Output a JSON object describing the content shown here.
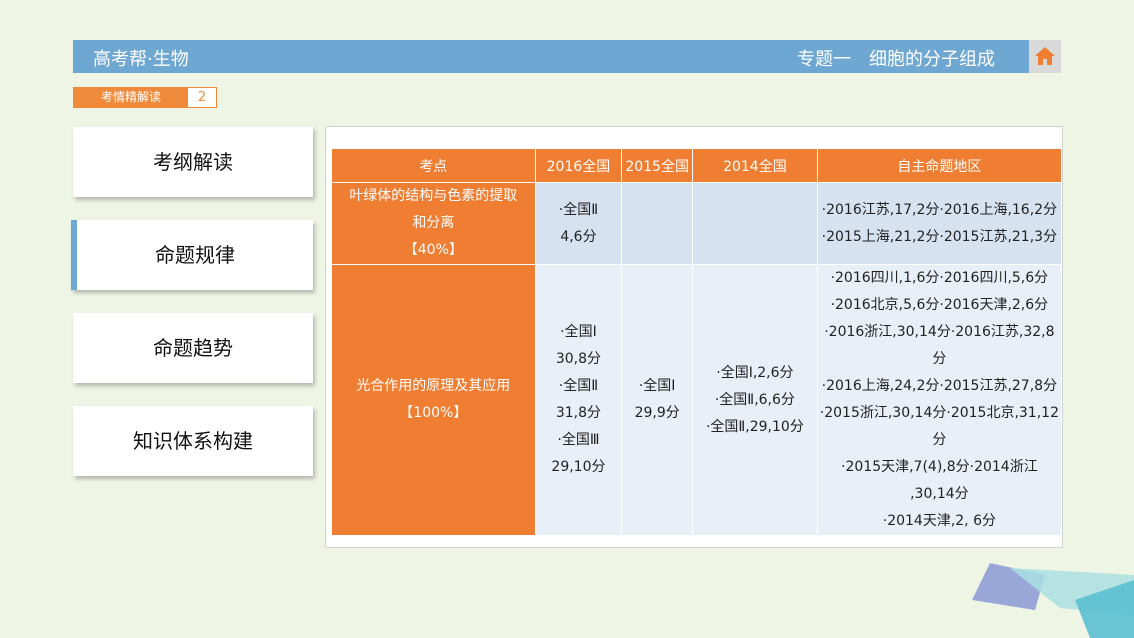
{
  "header": {
    "brand": "高考帮·生物",
    "topic": "专题一　细胞的分子组成"
  },
  "sub_tab": {
    "label": "考情精解读",
    "number": "2"
  },
  "nav": [
    {
      "label": "考纲解读"
    },
    {
      "label": "命题规律"
    },
    {
      "label": "命题趋势"
    },
    {
      "label": "知识体系构建"
    }
  ],
  "table": {
    "headers": [
      "考点",
      "2016全国",
      "2015全国",
      "2014全国",
      "自主命题地区"
    ],
    "rows": [
      {
        "topic": [
          "叶绿体的结构与色素的提取",
          "和分离",
          "【40%】"
        ],
        "y2016": [
          "·全国Ⅱ",
          "4,6分"
        ],
        "y2015": [],
        "y2014": [],
        "regions": [
          "·2016江苏,17,2分·2016上海,16,2分",
          "·2015上海,21,2分·2015江苏,21,3分"
        ]
      },
      {
        "topic": [
          "光合作用的原理及其应用",
          "【100%】"
        ],
        "y2016": [
          "·全国Ⅰ",
          "30,8分",
          "·全国Ⅱ",
          "31,8分",
          "·全国Ⅲ",
          "29,10分"
        ],
        "y2015": [
          "·全国Ⅰ",
          "29,9分"
        ],
        "y2014": [
          "·全国Ⅰ,2,6分",
          "·全国Ⅱ,6,6分",
          "·全国Ⅱ,29,10分"
        ],
        "regions": [
          "·2016四川,1,6分·2016四川,5,6分",
          "·2016北京,5,6分·2016天津,2,6分",
          "·2016浙江,30,14分·2016江苏,32,8",
          "分",
          "·2016上海,24,2分·2015江苏,27,8分",
          "·2015浙江,30,14分·2015北京,31,12",
          "分",
          "·2015天津,7(4),8分·2014浙江",
          ",30,14分",
          "·2014天津,2, 6分"
        ]
      }
    ]
  },
  "colors": {
    "header_blue": "#6ea7d1",
    "accent_orange": "#ef7e33",
    "background": "#eef5e5"
  },
  "icons": {
    "home": "home-icon"
  }
}
